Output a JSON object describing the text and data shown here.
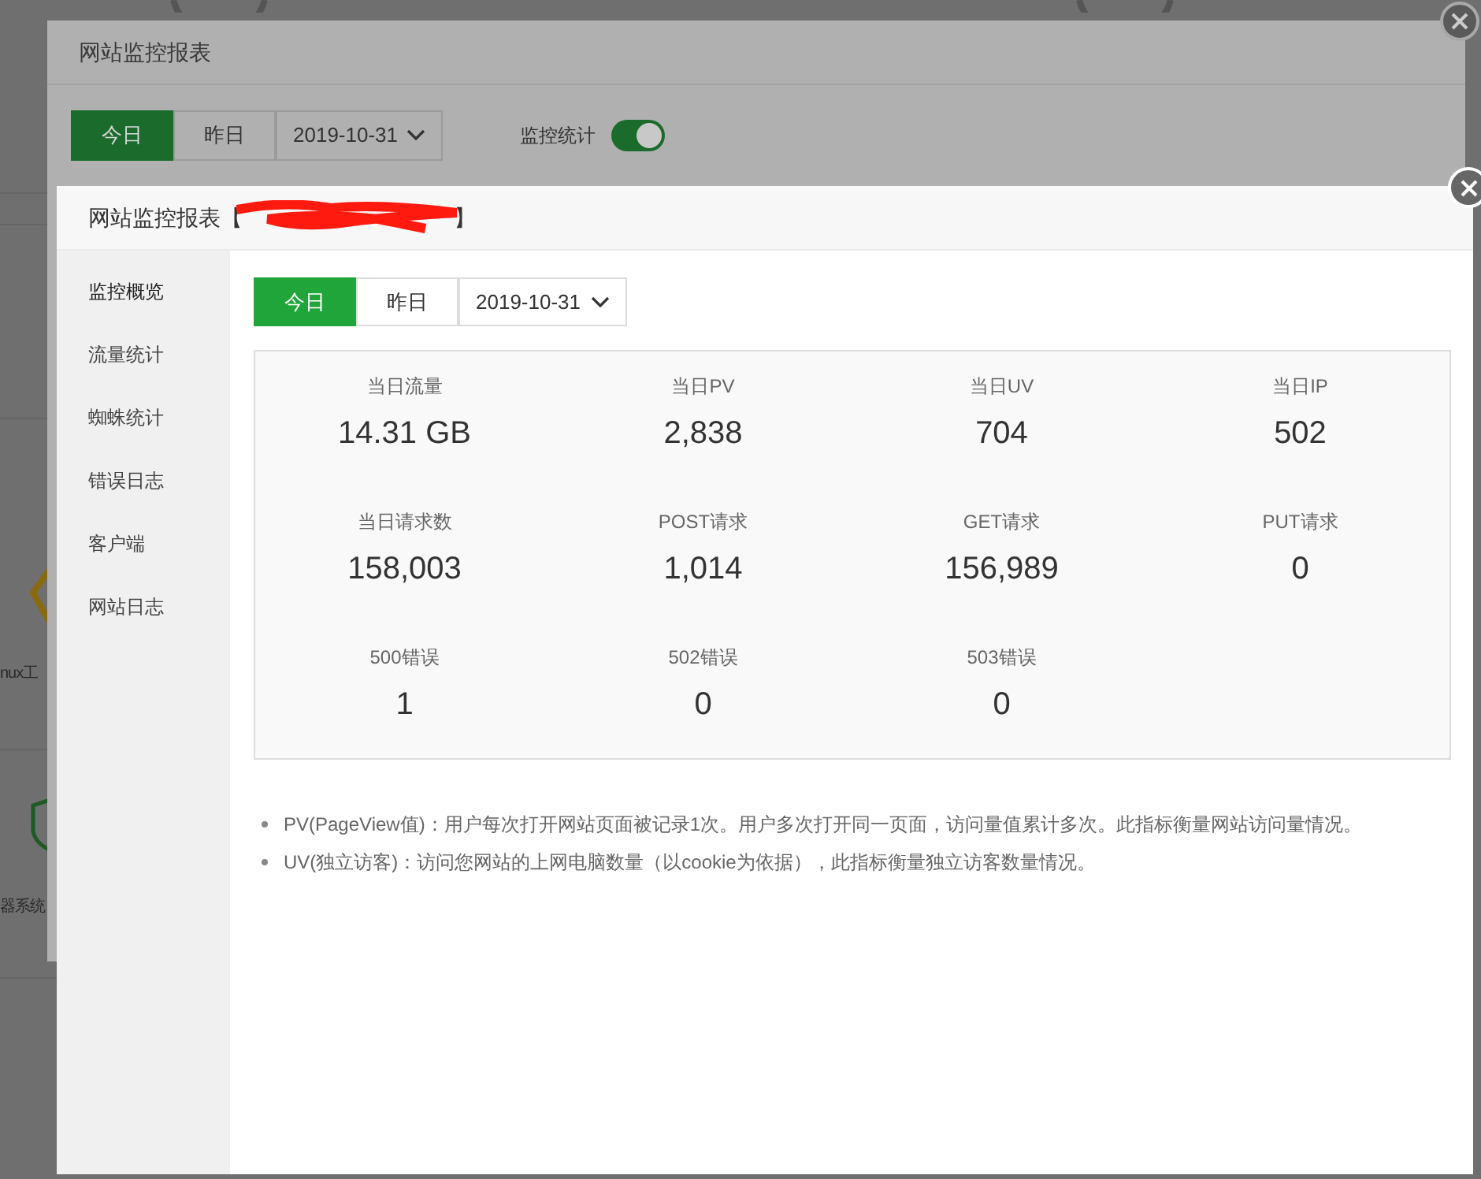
{
  "background_page": {
    "items": [
      {
        "label": "nux工",
        "kind": "tool"
      },
      {
        "label": "器系统",
        "kind": "shield"
      }
    ]
  },
  "back_dialog": {
    "title": "网站监控报表",
    "day_tabs": [
      {
        "label": "今日",
        "selected": true
      },
      {
        "label": "昨日",
        "selected": false
      }
    ],
    "date": "2019-10-31",
    "monitor_toggle": {
      "label": "监控统计",
      "on": true
    }
  },
  "dialog": {
    "title_prefix": "网站监控报表【",
    "title_redacted": true,
    "title_suffix": "】",
    "sidebar": [
      {
        "label": "监控概览",
        "selected": true
      },
      {
        "label": "流量统计",
        "selected": false
      },
      {
        "label": "蜘蛛统计",
        "selected": false
      },
      {
        "label": "错误日志",
        "selected": false
      },
      {
        "label": "客户端",
        "selected": false
      },
      {
        "label": "网站日志",
        "selected": false
      }
    ],
    "day_tabs": [
      {
        "label": "今日",
        "selected": true
      },
      {
        "label": "昨日",
        "selected": false
      }
    ],
    "date": "2019-10-31",
    "stats": [
      {
        "label": "当日流量",
        "value": "14.31 GB"
      },
      {
        "label": "当日PV",
        "value": "2,838"
      },
      {
        "label": "当日UV",
        "value": "704"
      },
      {
        "label": "当日IP",
        "value": "502"
      },
      {
        "label": "当日请求数",
        "value": "158,003"
      },
      {
        "label": "POST请求",
        "value": "1,014"
      },
      {
        "label": "GET请求",
        "value": "156,989"
      },
      {
        "label": "PUT请求",
        "value": "0"
      },
      {
        "label": "500错误",
        "value": "1"
      },
      {
        "label": "502错误",
        "value": "0"
      },
      {
        "label": "503错误",
        "value": "0"
      }
    ],
    "notes": [
      "PV(PageView值)：用户每次打开网站页面被记录1次。用户多次打开同一页面，访问量值累计多次。此指标衡量网站访问量情况。",
      "UV(独立访客)：访问您网站的上网电脑数量（以cookie为依据），此指标衡量独立访客数量情况。"
    ]
  }
}
